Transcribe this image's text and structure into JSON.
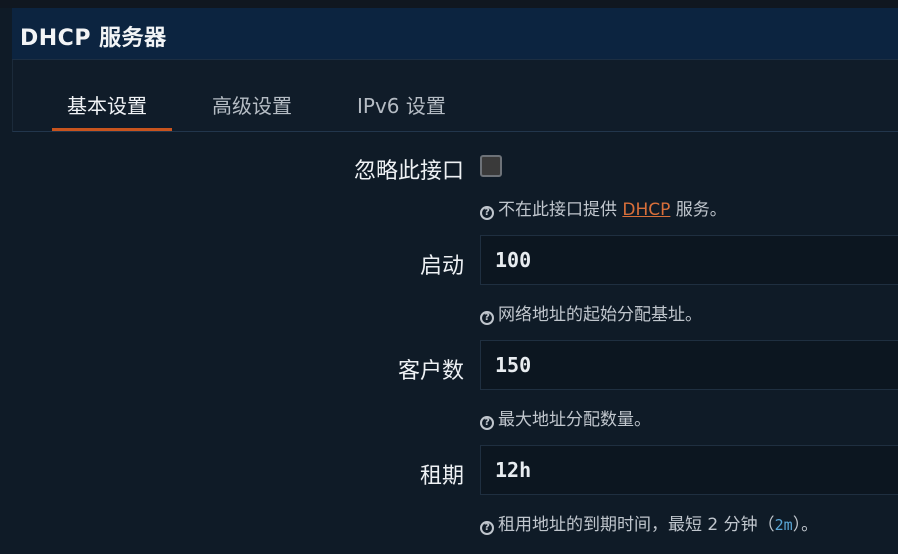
{
  "header": {
    "title": "DHCP 服务器"
  },
  "tabs": [
    {
      "label": "基本设置",
      "active": true
    },
    {
      "label": "高级设置",
      "active": false
    },
    {
      "label": "IPv6 设置",
      "active": false
    }
  ],
  "fields": {
    "ignore": {
      "label": "忽略此接口",
      "checked": false,
      "help_prefix": "不在此接口提供 ",
      "help_link": "DHCP",
      "help_suffix": " 服务。"
    },
    "start": {
      "label": "启动",
      "value": "100",
      "help": "网络地址的起始分配基址。"
    },
    "limit": {
      "label": "客户数",
      "value": "150",
      "help": "最大地址分配数量。"
    },
    "leasetime": {
      "label": "租期",
      "value": "12h",
      "help_prefix": "租用地址的到期时间，最短 2 分钟（",
      "help_code": "2m",
      "help_suffix": "）。"
    }
  },
  "colors": {
    "accent": "#c8541e",
    "link": "#d86f3a",
    "header_bg": "#0c2440",
    "page_bg": "#0f1b27"
  },
  "icons": {
    "help": "help-circle-icon"
  }
}
